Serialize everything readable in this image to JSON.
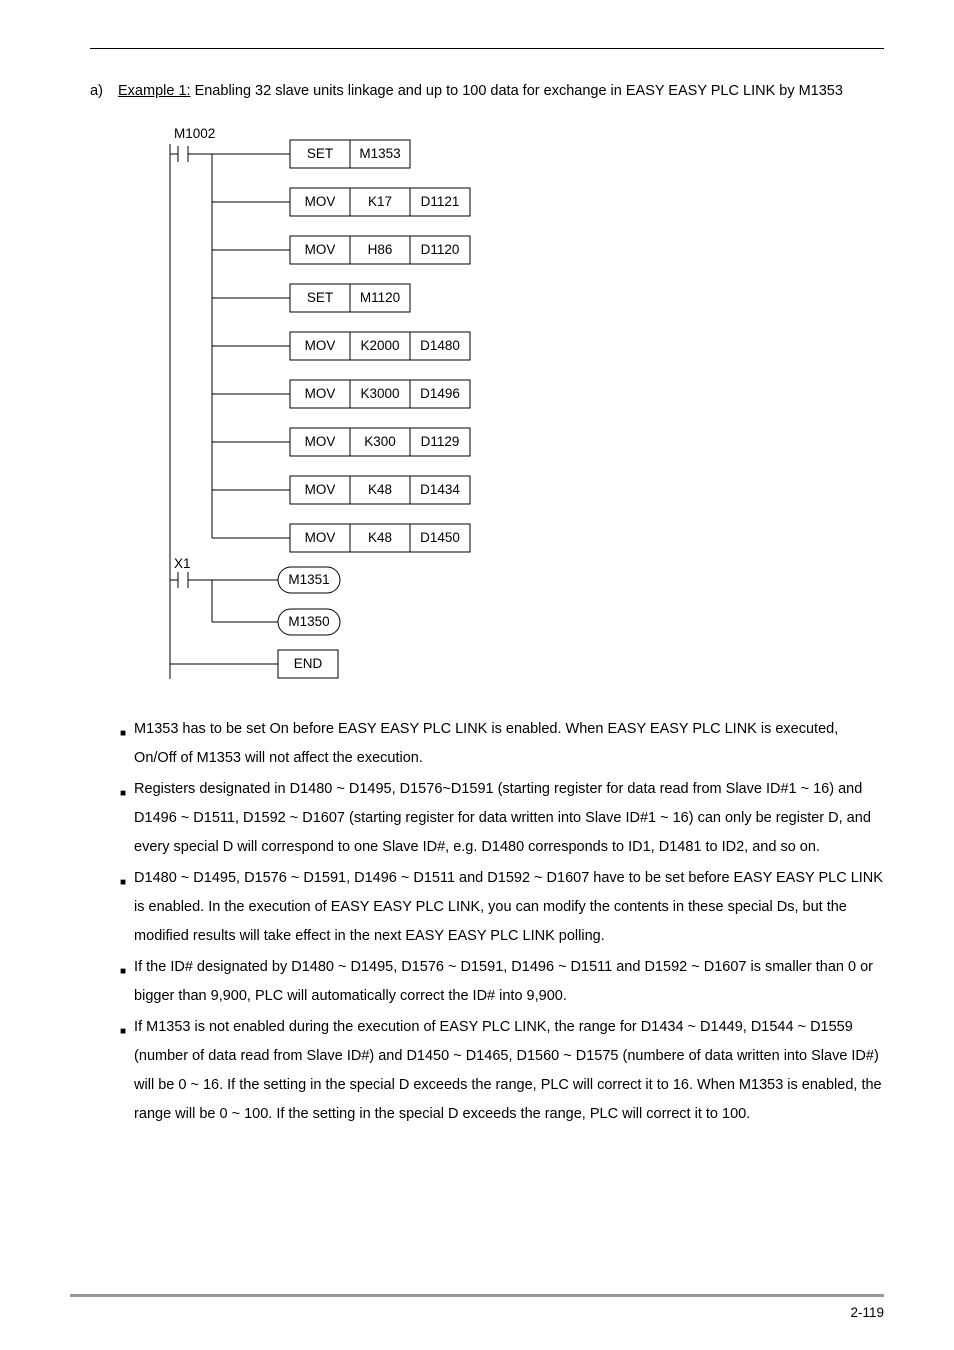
{
  "list": {
    "marker": "a)",
    "text_prefix": "Example 1:",
    "text_rest": " Enabling 32 slave units linkage and up to 100 data for exchange in EASY EASY PLC LINK by M1353"
  },
  "ladder": {
    "rung1_label": "M1002",
    "rung2_label": "X1",
    "boxes": [
      {
        "a": "SET",
        "b": "M1353",
        "c": ""
      },
      {
        "a": "MOV",
        "b": "K17",
        "c": "D1121"
      },
      {
        "a": "MOV",
        "b": "H86",
        "c": "D1120"
      },
      {
        "a": "SET",
        "b": "M1120",
        "c": ""
      },
      {
        "a": "MOV",
        "b": "K2000",
        "c": "D1480"
      },
      {
        "a": "MOV",
        "b": "K3000",
        "c": "D1496"
      },
      {
        "a": "MOV",
        "b": "K300",
        "c": "D1129"
      },
      {
        "a": "MOV",
        "b": "K48",
        "c": "D1434"
      },
      {
        "a": "MOV",
        "b": "K48",
        "c": "D1450"
      }
    ],
    "coil1": "M1351",
    "coil2": "M1350",
    "end": "END"
  },
  "bullets": [
    "M1353 has to be set On before EASY EASY PLC LINK is enabled. When EASY EASY PLC LINK is executed, On/Off of M1353 will not affect the execution.",
    "Registers designated in D1480 ~ D1495, D1576~D1591 (starting register for data read from Slave ID#1 ~ 16) and D1496 ~ D1511, D1592 ~ D1607 (starting register for data written into Slave ID#1 ~ 16) can only be register D, and every special D will correspond to one Slave ID#, e.g. D1480 corresponds to ID1, D1481 to ID2, and so on.",
    "D1480 ~ D1495, D1576 ~ D1591, D1496 ~ D1511 and D1592 ~ D1607 have to be set before EASY EASY PLC LINK is enabled. In the execution of EASY EASY PLC LINK, you can modify the contents in these special Ds, but the modified results will take effect in the next EASY EASY PLC LINK polling.",
    "If the ID# designated by D1480 ~ D1495, D1576 ~ D1591, D1496 ~ D1511 and D1592 ~ D1607 is smaller than 0 or bigger than 9,900, PLC will automatically correct the ID# into 9,900.",
    "If M1353 is not enabled during the execution of EASY PLC LINK, the range for D1434 ~ D1449, D1544 ~ D1559 (number of data read from Slave ID#) and D1450 ~ D1465, D1560 ~ D1575 (numbere of data written into Slave ID#) will be 0 ~ 16. If the setting in the special D exceeds the range, PLC will correct it to 16. When M1353 is enabled, the range will be 0 ~ 100. If the setting in the special D exceeds the range, PLC will correct it to 100."
  ],
  "pagenum": "2-119"
}
